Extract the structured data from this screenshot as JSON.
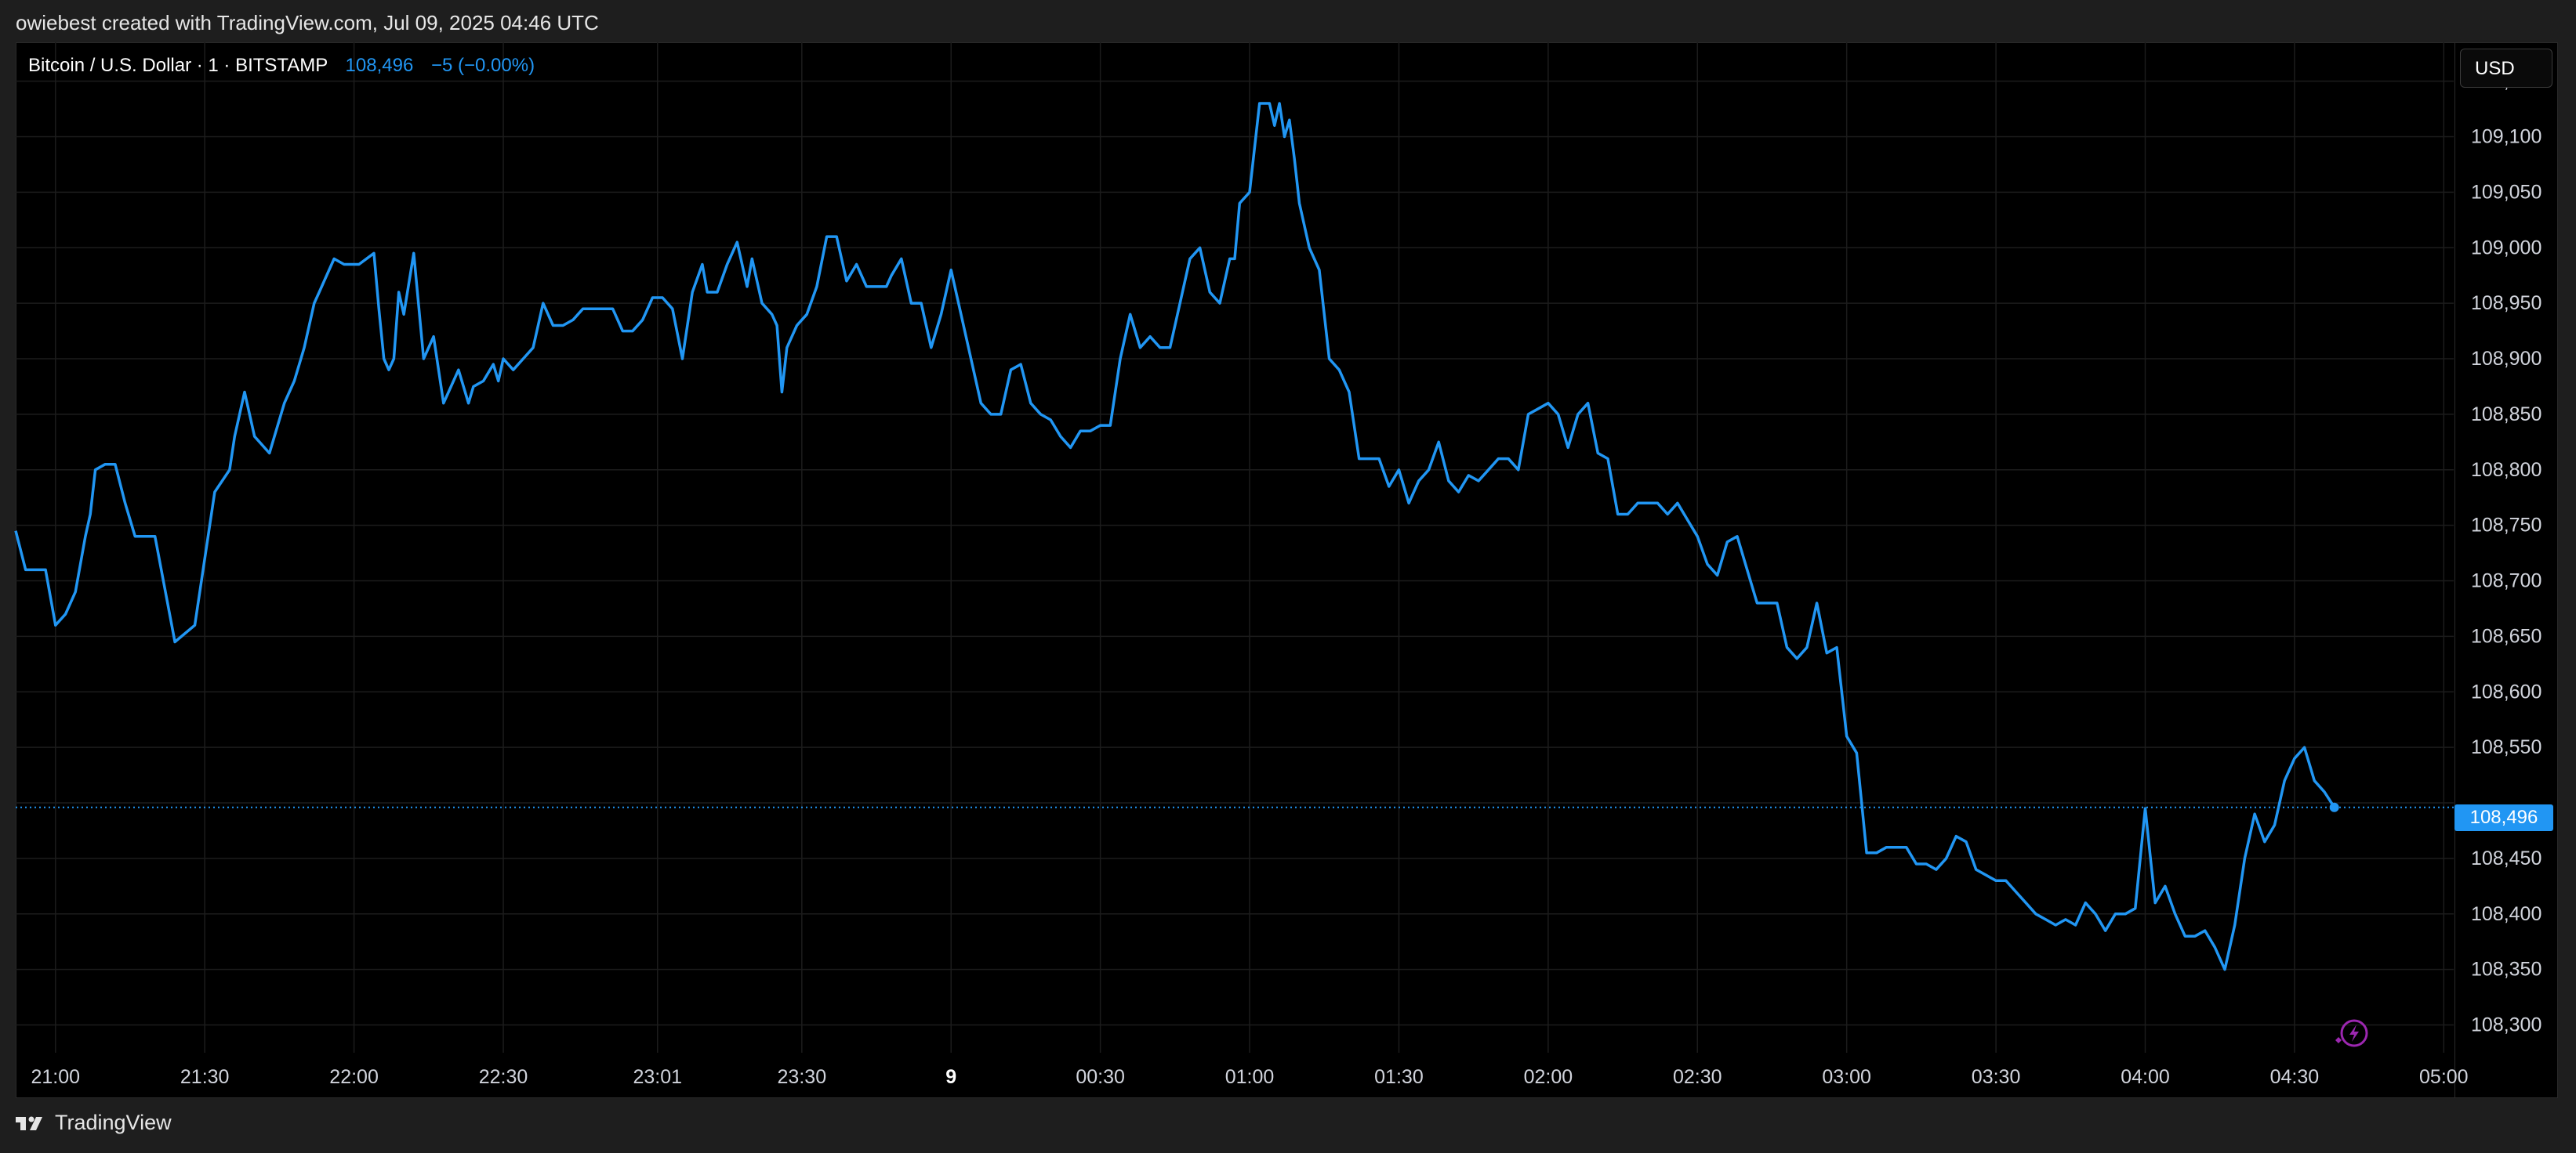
{
  "header": {
    "text": "owiebest created with TradingView.com, Jul 09, 2025 04:46 UTC"
  },
  "legend": {
    "symbol": "Bitcoin / U.S. Dollar · 1 · BITSTAMP",
    "last": "108,496",
    "change": "−5 (−0.00%)"
  },
  "currency": "USD",
  "last_price_tag": "108,496",
  "footer": {
    "brand": "TradingView"
  },
  "colors": {
    "line": "#2196f3",
    "background": "#000000",
    "grid": "#1c1c1c",
    "accent_icon": "#9c27b0"
  },
  "chart_data": {
    "type": "line",
    "title": "Bitcoin / U.S. Dollar · 1 · BITSTAMP",
    "x_ticks": [
      "21:00",
      "21:30",
      "22:00",
      "22:30",
      "23:01",
      "23:30",
      "9",
      "00:30",
      "01:00",
      "01:30",
      "02:00",
      "02:30",
      "03:00",
      "03:30",
      "04:00",
      "04:30",
      "05:00"
    ],
    "x_tick_minutes": [
      0,
      30,
      60,
      90,
      121,
      150,
      180,
      210,
      240,
      270,
      300,
      330,
      360,
      390,
      420,
      450,
      480
    ],
    "y_ticks": [
      108300,
      108350,
      108400,
      108450,
      108500,
      108550,
      108600,
      108650,
      108700,
      108750,
      108800,
      108850,
      108900,
      108950,
      109000,
      109050,
      109100,
      109150
    ],
    "y_tick_labels": [
      "108,300",
      "108,350",
      "108,400",
      "108,450",
      "108,500",
      "108,550",
      "108,600",
      "108,650",
      "108,700",
      "108,750",
      "108,800",
      "108,850",
      "108,900",
      "108,950",
      "109,000",
      "109,050",
      "109,100",
      "109,150"
    ],
    "ylim": [
      108275,
      109185
    ],
    "xlim_minutes": [
      -8,
      482
    ],
    "last_price": 108496,
    "grid": true,
    "series": [
      {
        "points_minutes": [
          -8,
          -6,
          -4,
          -2,
          0,
          2,
          4,
          6,
          7,
          8,
          10,
          12,
          14,
          16,
          18,
          20,
          24,
          28,
          32,
          35,
          36,
          38,
          40,
          43,
          46,
          48,
          50,
          52,
          53,
          54,
          56,
          58,
          61,
          64,
          65,
          66,
          67,
          68,
          69,
          70,
          72,
          74,
          76,
          78,
          81,
          83,
          84,
          86,
          88,
          89,
          90,
          92,
          94,
          96,
          98,
          100,
          102,
          104,
          106,
          108,
          110,
          112,
          114,
          116,
          118,
          120,
          122,
          124,
          126,
          128,
          130,
          131,
          133,
          135,
          137,
          139,
          140,
          142,
          144,
          145,
          146,
          147,
          149,
          151,
          153,
          155,
          157,
          159,
          161,
          163,
          165,
          167,
          168,
          170,
          172,
          174,
          176,
          178,
          180,
          182,
          184,
          186,
          188,
          190,
          192,
          194,
          196,
          198,
          200,
          202,
          204,
          206,
          208,
          210,
          212,
          214,
          216,
          218,
          220,
          222,
          224,
          226,
          228,
          230,
          232,
          234,
          236,
          237,
          238,
          240,
          242,
          244,
          245,
          246,
          247,
          248,
          249,
          250,
          252,
          254,
          256,
          258,
          260,
          262,
          264,
          266,
          268,
          270,
          272,
          274,
          276,
          278,
          280,
          282,
          284,
          286,
          288,
          290,
          292,
          294,
          296,
          298,
          300,
          302,
          304,
          306,
          308,
          310,
          312,
          314,
          316,
          318,
          320,
          322,
          324,
          326,
          328,
          330,
          332,
          334,
          336,
          338,
          340,
          342,
          344,
          346,
          348,
          350,
          352,
          354,
          356,
          358,
          360,
          362,
          364,
          366,
          368,
          370,
          372,
          374,
          376,
          378,
          380,
          382,
          384,
          386,
          388,
          390,
          392,
          394,
          396,
          398,
          400,
          402,
          404,
          406,
          408,
          410,
          412,
          414,
          416,
          418,
          420,
          422,
          424,
          426,
          428,
          430,
          432,
          434,
          436,
          438,
          440,
          442,
          444,
          446,
          448,
          450,
          452,
          454,
          456,
          458
        ],
        "values": [
          108745,
          108710,
          108710,
          108710,
          108660,
          108670,
          108690,
          108740,
          108760,
          108800,
          108805,
          108805,
          108770,
          108740,
          108740,
          108740,
          108645,
          108660,
          108780,
          108800,
          108830,
          108870,
          108830,
          108815,
          108860,
          108880,
          108910,
          108950,
          108960,
          108970,
          108990,
          108985,
          108985,
          108995,
          108945,
          108900,
          108890,
          108900,
          108960,
          108940,
          108995,
          108900,
          108920,
          108860,
          108890,
          108860,
          108875,
          108880,
          108895,
          108880,
          108900,
          108890,
          108900,
          108910,
          108950,
          108930,
          108930,
          108935,
          108945,
          108945,
          108945,
          108945,
          108925,
          108925,
          108935,
          108955,
          108955,
          108945,
          108900,
          108960,
          108985,
          108960,
          108960,
          108985,
          109005,
          108965,
          108990,
          108950,
          108940,
          108930,
          108870,
          108910,
          108930,
          108940,
          108965,
          109010,
          109010,
          108970,
          108985,
          108965,
          108965,
          108965,
          108975,
          108990,
          108950,
          108950,
          108910,
          108940,
          108980,
          108940,
          108900,
          108860,
          108850,
          108850,
          108890,
          108895,
          108860,
          108850,
          108845,
          108830,
          108820,
          108835,
          108835,
          108840,
          108840,
          108900,
          108940,
          108910,
          108920,
          108910,
          108910,
          108950,
          108990,
          109000,
          108960,
          108950,
          108990,
          108990,
          109040,
          109050,
          109130,
          109130,
          109110,
          109130,
          109100,
          109115,
          109080,
          109040,
          109000,
          108980,
          108900,
          108890,
          108870,
          108810,
          108810,
          108810,
          108785,
          108800,
          108770,
          108790,
          108800,
          108825,
          108790,
          108780,
          108795,
          108790,
          108800,
          108810,
          108810,
          108800,
          108850,
          108855,
          108860,
          108850,
          108820,
          108850,
          108860,
          108815,
          108810,
          108760,
          108760,
          108770,
          108770,
          108770,
          108760,
          108770,
          108755,
          108740,
          108715,
          108705,
          108735,
          108740,
          108710,
          108680,
          108680,
          108680,
          108640,
          108630,
          108640,
          108680,
          108635,
          108640,
          108560,
          108545,
          108455,
          108455,
          108460,
          108460,
          108460,
          108445,
          108445,
          108440,
          108450,
          108470,
          108465,
          108440,
          108435,
          108430,
          108430,
          108420,
          108410,
          108400,
          108395,
          108390,
          108395,
          108390,
          108410,
          108400,
          108385,
          108400,
          108400,
          108405,
          108495,
          108410,
          108425,
          108400,
          108380,
          108380,
          108385,
          108370,
          108350,
          108390,
          108450,
          108490,
          108465,
          108480,
          108520,
          108540,
          108550,
          108520,
          108510,
          108496
        ]
      }
    ]
  }
}
